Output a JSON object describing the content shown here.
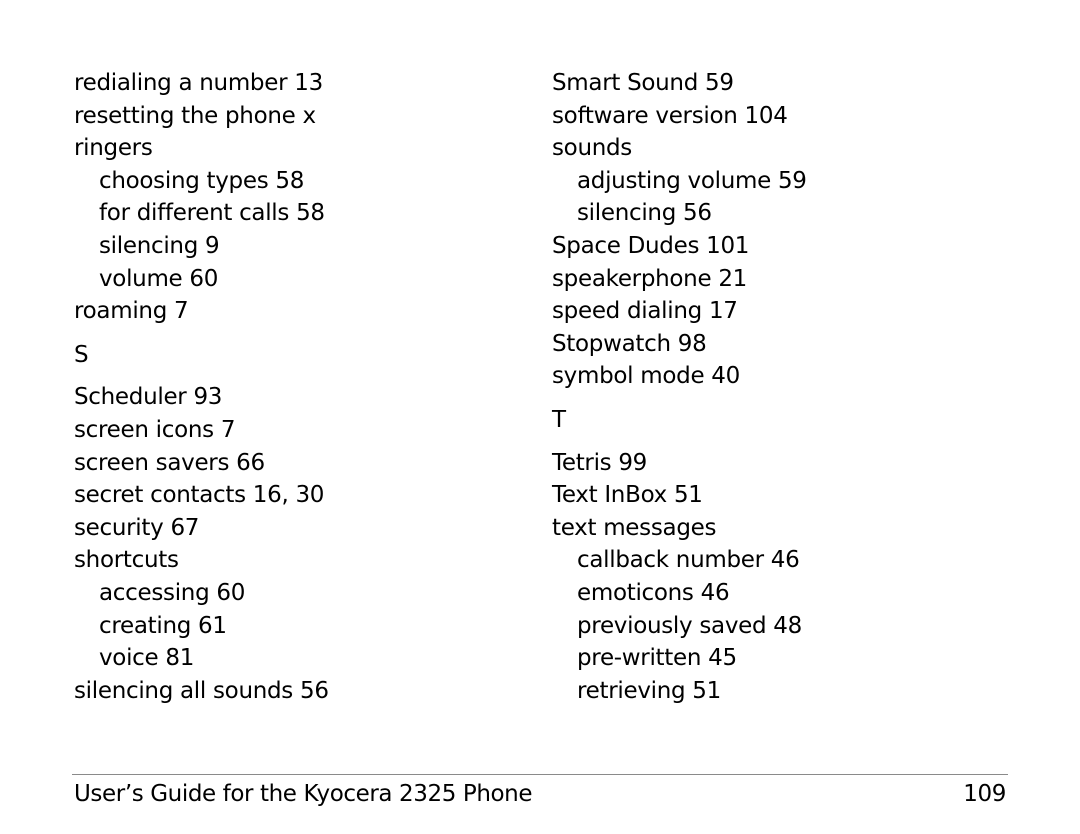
{
  "index": {
    "left_column": [
      {
        "type": "entry",
        "text": "redialing a number 13"
      },
      {
        "type": "entry",
        "text": "resetting the phone x"
      },
      {
        "type": "entry",
        "text": "ringers"
      },
      {
        "type": "sub",
        "text": "choosing types 58"
      },
      {
        "type": "sub",
        "text": "for different calls 58"
      },
      {
        "type": "sub",
        "text": "silencing 9"
      },
      {
        "type": "sub",
        "text": "volume 60"
      },
      {
        "type": "entry",
        "text": "roaming 7"
      },
      {
        "type": "letter",
        "text": "S"
      },
      {
        "type": "entry",
        "text": "Scheduler 93"
      },
      {
        "type": "entry",
        "text": "screen icons 7"
      },
      {
        "type": "entry",
        "text": "screen savers 66"
      },
      {
        "type": "entry",
        "text": "secret contacts 16, 30"
      },
      {
        "type": "entry",
        "text": "security 67"
      },
      {
        "type": "entry",
        "text": "shortcuts"
      },
      {
        "type": "sub",
        "text": "accessing 60"
      },
      {
        "type": "sub",
        "text": "creating 61"
      },
      {
        "type": "sub",
        "text": "voice 81"
      },
      {
        "type": "entry",
        "text": "silencing all sounds 56"
      }
    ],
    "right_column": [
      {
        "type": "entry",
        "text": "Smart Sound 59"
      },
      {
        "type": "entry",
        "text": "software version 104"
      },
      {
        "type": "entry",
        "text": "sounds"
      },
      {
        "type": "sub",
        "text": "adjusting volume 59"
      },
      {
        "type": "sub",
        "text": "silencing 56"
      },
      {
        "type": "entry",
        "text": "Space Dudes 101"
      },
      {
        "type": "entry",
        "text": "speakerphone 21"
      },
      {
        "type": "entry",
        "text": "speed dialing 17"
      },
      {
        "type": "entry",
        "text": "Stopwatch 98"
      },
      {
        "type": "entry",
        "text": "symbol mode 40"
      },
      {
        "type": "letter",
        "text": "T"
      },
      {
        "type": "entry",
        "text": "Tetris 99"
      },
      {
        "type": "entry",
        "text": "Text InBox 51"
      },
      {
        "type": "entry",
        "text": "text messages"
      },
      {
        "type": "sub",
        "text": "callback number 46"
      },
      {
        "type": "sub",
        "text": "emoticons 46"
      },
      {
        "type": "sub",
        "text": "previously saved 48"
      },
      {
        "type": "sub",
        "text": "pre-written 45"
      },
      {
        "type": "sub",
        "text": "retrieving 51"
      }
    ]
  },
  "footer": {
    "title": "User’s Guide for the Kyocera 2325 Phone",
    "page_number": "109"
  }
}
